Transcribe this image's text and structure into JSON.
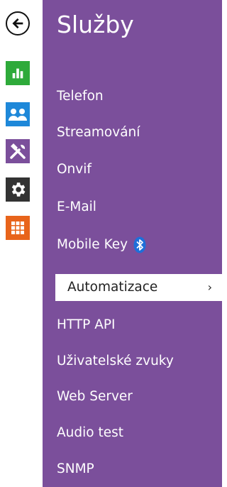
{
  "header": {
    "title": "Služby"
  },
  "rail": {
    "back": {
      "icon": "arrow-left-icon"
    },
    "items": [
      {
        "icon": "bar-chart-icon",
        "color": "#2eaa3a"
      },
      {
        "icon": "users-icon",
        "color": "#1e88d9"
      },
      {
        "icon": "tools-icon",
        "color": "#7b4f9b"
      },
      {
        "icon": "gear-icon",
        "color": "#333333"
      },
      {
        "icon": "grid-icon",
        "color": "#e8641b"
      }
    ]
  },
  "menu": {
    "items": [
      {
        "label": "Telefon"
      },
      {
        "label": "Streamování"
      },
      {
        "label": "Onvif"
      },
      {
        "label": "E-Mail"
      },
      {
        "label": "Mobile Key",
        "icon": "bluetooth-icon"
      },
      {
        "label": "Automatizace",
        "active": true
      },
      {
        "label": "HTTP API"
      },
      {
        "label": "Uživatelské zvuky"
      },
      {
        "label": "Web Server"
      },
      {
        "label": "Audio test"
      },
      {
        "label": "SNMP"
      }
    ]
  },
  "colors": {
    "panel": "#7b4f9b",
    "active_bg": "#ffffff",
    "bluetooth": "#1e6fd9"
  }
}
